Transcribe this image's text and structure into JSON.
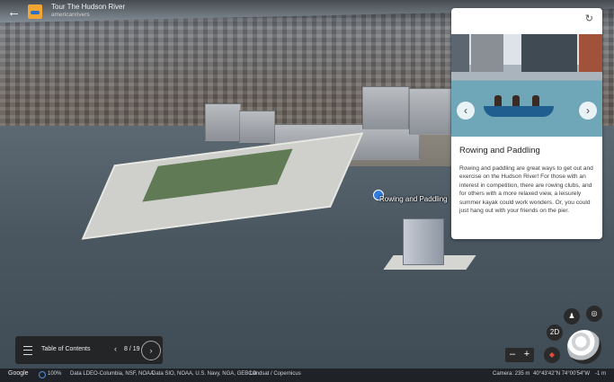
{
  "header": {
    "back_icon": "arrow-left-icon",
    "title": "Tour The Hudson River",
    "subtitle": "americanrivers"
  },
  "map": {
    "place_label": "Rowing and Paddling"
  },
  "card": {
    "refresh_icon": "refresh-icon",
    "prev_icon": "chevron-left-icon",
    "next_icon": "chevron-right-icon",
    "title": "Rowing and Paddling",
    "body": "Rowing and paddling are great ways to get out and exercise on the Hudson River! For those with an interest in competition, there are rowing clubs, and for others with a more relaxed view, a leisurely summer kayak could work wonders. Or, you could just hang out with your friends on the pier."
  },
  "toc": {
    "label": "Table of Contents",
    "prev": "‹",
    "page": "8 / 19",
    "next": "›"
  },
  "controls": {
    "view_mode": "2D",
    "zoom_out": "–",
    "zoom_in": "+",
    "compass_icon": "compass-icon",
    "pegman_icon": "pegman-icon",
    "locate_icon": "locate-icon"
  },
  "status": {
    "brand": "Google",
    "zoom": "100%",
    "data_attribution": "Data LDEO-Columbia, NSF, NOAA",
    "data_attribution_2": "Data SIO, NOAA, U.S. Navy, NGA, GEBCO",
    "imagery": "Landsat / Copernicus",
    "camera": "Camera: 235 m",
    "coords": "40°43'42\"N 74°00'54\"W",
    "altitude": "-1 m"
  }
}
